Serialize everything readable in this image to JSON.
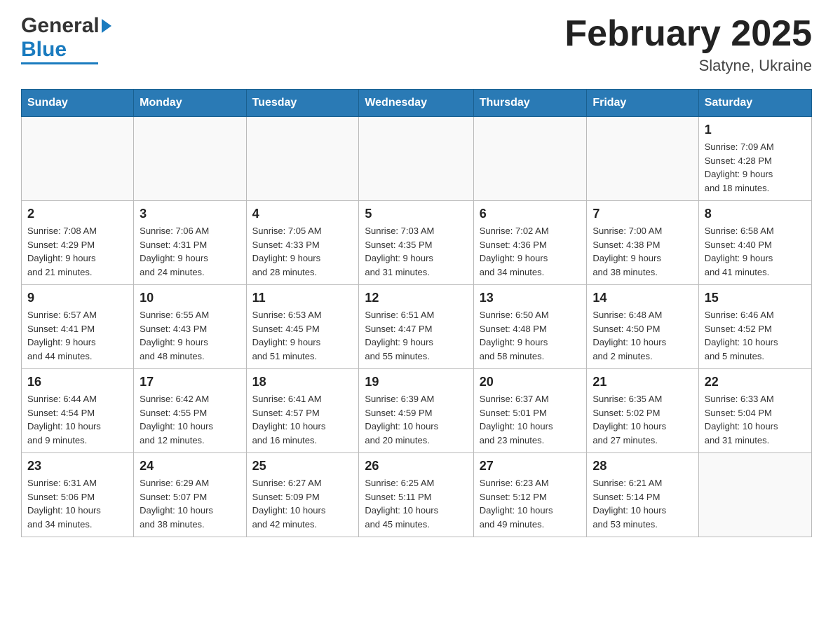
{
  "header": {
    "logo": {
      "general": "General",
      "blue": "Blue"
    },
    "title": "February 2025",
    "location": "Slatyne, Ukraine"
  },
  "calendar": {
    "weekdays": [
      "Sunday",
      "Monday",
      "Tuesday",
      "Wednesday",
      "Thursday",
      "Friday",
      "Saturday"
    ],
    "weeks": [
      [
        {
          "day": "",
          "info": ""
        },
        {
          "day": "",
          "info": ""
        },
        {
          "day": "",
          "info": ""
        },
        {
          "day": "",
          "info": ""
        },
        {
          "day": "",
          "info": ""
        },
        {
          "day": "",
          "info": ""
        },
        {
          "day": "1",
          "info": "Sunrise: 7:09 AM\nSunset: 4:28 PM\nDaylight: 9 hours\nand 18 minutes."
        }
      ],
      [
        {
          "day": "2",
          "info": "Sunrise: 7:08 AM\nSunset: 4:29 PM\nDaylight: 9 hours\nand 21 minutes."
        },
        {
          "day": "3",
          "info": "Sunrise: 7:06 AM\nSunset: 4:31 PM\nDaylight: 9 hours\nand 24 minutes."
        },
        {
          "day": "4",
          "info": "Sunrise: 7:05 AM\nSunset: 4:33 PM\nDaylight: 9 hours\nand 28 minutes."
        },
        {
          "day": "5",
          "info": "Sunrise: 7:03 AM\nSunset: 4:35 PM\nDaylight: 9 hours\nand 31 minutes."
        },
        {
          "day": "6",
          "info": "Sunrise: 7:02 AM\nSunset: 4:36 PM\nDaylight: 9 hours\nand 34 minutes."
        },
        {
          "day": "7",
          "info": "Sunrise: 7:00 AM\nSunset: 4:38 PM\nDaylight: 9 hours\nand 38 minutes."
        },
        {
          "day": "8",
          "info": "Sunrise: 6:58 AM\nSunset: 4:40 PM\nDaylight: 9 hours\nand 41 minutes."
        }
      ],
      [
        {
          "day": "9",
          "info": "Sunrise: 6:57 AM\nSunset: 4:41 PM\nDaylight: 9 hours\nand 44 minutes."
        },
        {
          "day": "10",
          "info": "Sunrise: 6:55 AM\nSunset: 4:43 PM\nDaylight: 9 hours\nand 48 minutes."
        },
        {
          "day": "11",
          "info": "Sunrise: 6:53 AM\nSunset: 4:45 PM\nDaylight: 9 hours\nand 51 minutes."
        },
        {
          "day": "12",
          "info": "Sunrise: 6:51 AM\nSunset: 4:47 PM\nDaylight: 9 hours\nand 55 minutes."
        },
        {
          "day": "13",
          "info": "Sunrise: 6:50 AM\nSunset: 4:48 PM\nDaylight: 9 hours\nand 58 minutes."
        },
        {
          "day": "14",
          "info": "Sunrise: 6:48 AM\nSunset: 4:50 PM\nDaylight: 10 hours\nand 2 minutes."
        },
        {
          "day": "15",
          "info": "Sunrise: 6:46 AM\nSunset: 4:52 PM\nDaylight: 10 hours\nand 5 minutes."
        }
      ],
      [
        {
          "day": "16",
          "info": "Sunrise: 6:44 AM\nSunset: 4:54 PM\nDaylight: 10 hours\nand 9 minutes."
        },
        {
          "day": "17",
          "info": "Sunrise: 6:42 AM\nSunset: 4:55 PM\nDaylight: 10 hours\nand 12 minutes."
        },
        {
          "day": "18",
          "info": "Sunrise: 6:41 AM\nSunset: 4:57 PM\nDaylight: 10 hours\nand 16 minutes."
        },
        {
          "day": "19",
          "info": "Sunrise: 6:39 AM\nSunset: 4:59 PM\nDaylight: 10 hours\nand 20 minutes."
        },
        {
          "day": "20",
          "info": "Sunrise: 6:37 AM\nSunset: 5:01 PM\nDaylight: 10 hours\nand 23 minutes."
        },
        {
          "day": "21",
          "info": "Sunrise: 6:35 AM\nSunset: 5:02 PM\nDaylight: 10 hours\nand 27 minutes."
        },
        {
          "day": "22",
          "info": "Sunrise: 6:33 AM\nSunset: 5:04 PM\nDaylight: 10 hours\nand 31 minutes."
        }
      ],
      [
        {
          "day": "23",
          "info": "Sunrise: 6:31 AM\nSunset: 5:06 PM\nDaylight: 10 hours\nand 34 minutes."
        },
        {
          "day": "24",
          "info": "Sunrise: 6:29 AM\nSunset: 5:07 PM\nDaylight: 10 hours\nand 38 minutes."
        },
        {
          "day": "25",
          "info": "Sunrise: 6:27 AM\nSunset: 5:09 PM\nDaylight: 10 hours\nand 42 minutes."
        },
        {
          "day": "26",
          "info": "Sunrise: 6:25 AM\nSunset: 5:11 PM\nDaylight: 10 hours\nand 45 minutes."
        },
        {
          "day": "27",
          "info": "Sunrise: 6:23 AM\nSunset: 5:12 PM\nDaylight: 10 hours\nand 49 minutes."
        },
        {
          "day": "28",
          "info": "Sunrise: 6:21 AM\nSunset: 5:14 PM\nDaylight: 10 hours\nand 53 minutes."
        },
        {
          "day": "",
          "info": ""
        }
      ]
    ]
  }
}
